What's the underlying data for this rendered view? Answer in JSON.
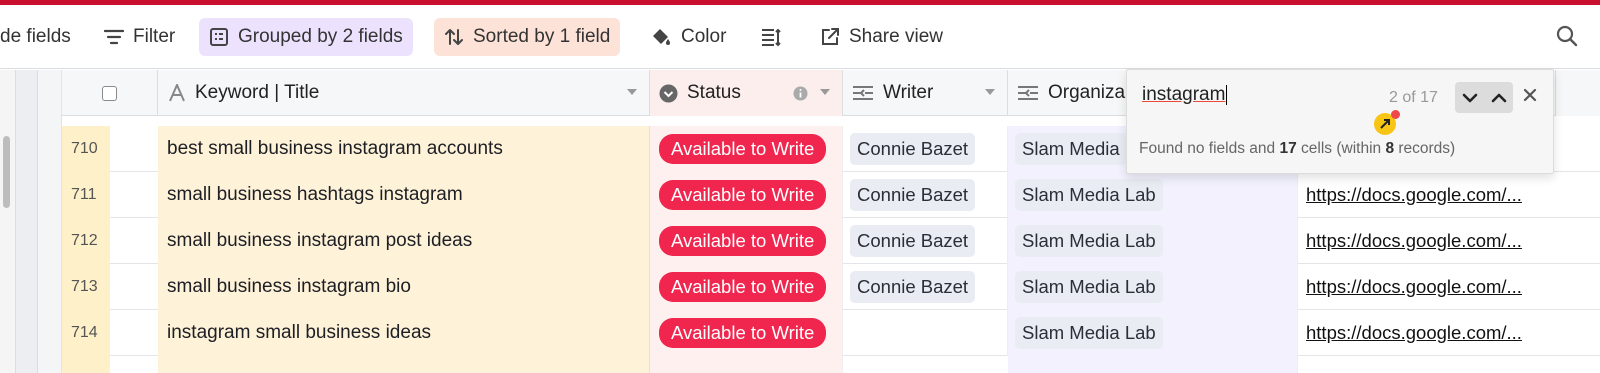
{
  "toolbar": {
    "hide_fields_label": "de fields",
    "filter_label": "Filter",
    "grouped_label": "Grouped by 2 fields",
    "sorted_label": "Sorted by 1 field",
    "color_label": "Color",
    "share_label": "Share view",
    "grouped_bg": "#ede2fe",
    "sorted_bg": "#fde2d8"
  },
  "columns": {
    "title": "Keyword | Title",
    "status": "Status",
    "writer": "Writer",
    "organization": "Organiza"
  },
  "find": {
    "query": "instagram",
    "count": "2 of 17",
    "summary_pre": "Found no fields and ",
    "cells": "17",
    "summary_mid": " cells (within ",
    "records": "8",
    "summary_post": " records)"
  },
  "rows": [
    {
      "num": "710",
      "title": "best small business instagram accounts",
      "status": "Available to Write",
      "writer": "Connie Bazet",
      "org": "Slam Media",
      "link": ""
    },
    {
      "num": "711",
      "title": "small business hashtags instagram",
      "status": "Available to Write",
      "writer": "Connie Bazet",
      "org": "Slam Media Lab",
      "link": "https://docs.google.com/..."
    },
    {
      "num": "712",
      "title": "small business instagram post ideas",
      "status": "Available to Write",
      "writer": "Connie Bazet",
      "org": "Slam Media Lab",
      "link": "https://docs.google.com/..."
    },
    {
      "num": "713",
      "title": "small business instagram bio",
      "status": "Available to Write",
      "writer": "Connie Bazet",
      "org": "Slam Media Lab",
      "link": "https://docs.google.com/..."
    },
    {
      "num": "714",
      "title": "instagram small business ideas",
      "status": "Available to Write",
      "writer": "",
      "org": "Slam Media Lab",
      "link": "https://docs.google.com/..."
    }
  ],
  "colors": {
    "status_pill": "#f0264f",
    "title_bg": "#fef2d8",
    "accent_bar": "#c8102e"
  }
}
